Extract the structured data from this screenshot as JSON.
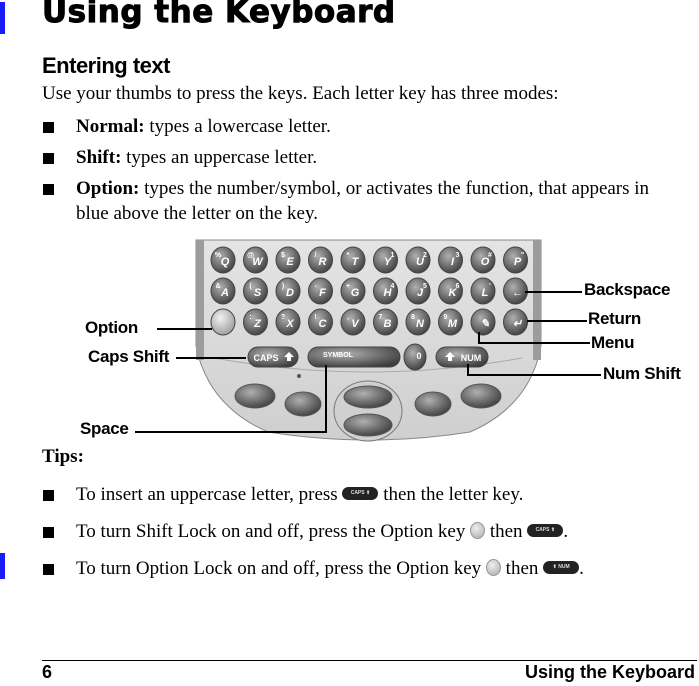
{
  "page": {
    "title": "Using the Keyboard",
    "section_heading": "Entering text",
    "intro": "Use your thumbs to press the keys. Each letter key has three modes:",
    "modes": [
      {
        "term": "Normal:",
        "text": " types a lowercase letter."
      },
      {
        "term": "Shift:",
        "text": " types an uppercase letter."
      },
      {
        "term": "Option:",
        "text": " types the number/symbol, or activates the function, that appears in blue above the letter on the key."
      }
    ],
    "figure": {
      "callouts": {
        "backspace": "Backspace",
        "return": "Return",
        "menu": "Menu",
        "num_shift": "Num Shift",
        "option": "Option",
        "caps_shift": "Caps Shift",
        "space": "Space"
      },
      "rows": [
        [
          {
            "k": "Q",
            "s": "%"
          },
          {
            "k": "W",
            "s": "@"
          },
          {
            "k": "E",
            "s": "$"
          },
          {
            "k": "R",
            "s": "/"
          },
          {
            "k": "T",
            "s": "*"
          },
          {
            "k": "Y",
            "s": "1"
          },
          {
            "k": "U",
            "s": "2"
          },
          {
            "k": "I",
            "s": "3"
          },
          {
            "k": "O",
            "s": "#"
          },
          {
            "k": "P",
            "s": "\""
          }
        ],
        [
          {
            "k": "A",
            "s": "&"
          },
          {
            "k": "S",
            "s": "("
          },
          {
            "k": "D",
            "s": ")"
          },
          {
            "k": "F",
            "s": "-"
          },
          {
            "k": "G",
            "s": "+"
          },
          {
            "k": "H",
            "s": "4"
          },
          {
            "k": "J",
            "s": "5"
          },
          {
            "k": "K",
            "s": "6"
          },
          {
            "k": "L",
            "s": "'"
          },
          {
            "k": "←",
            "s": ""
          }
        ],
        [
          {
            "k": "",
            "s": ""
          },
          {
            "k": "Z",
            "s": ":"
          },
          {
            "k": "X",
            "s": "?"
          },
          {
            "k": "C",
            "s": "!"
          },
          {
            "k": "V",
            "s": ","
          },
          {
            "k": "B",
            "s": "7"
          },
          {
            "k": "N",
            "s": "8"
          },
          {
            "k": "M",
            "s": "9"
          },
          {
            "k": "✎",
            "s": ""
          },
          {
            "k": "↵",
            "s": ""
          }
        ]
      ],
      "bottom_keys": {
        "caps": "CAPS",
        "symbol": "SYMBOL",
        "zero": "0",
        "num": "NUM"
      }
    },
    "tips_heading": "Tips:",
    "tips": [
      {
        "before": "To insert an uppercase letter, press ",
        "icon1": "caps-key",
        "mid": " then the letter key.",
        "icon2": "",
        "after": ""
      },
      {
        "before": "To turn Shift Lock on and off, press the Option key ",
        "icon1": "option-key",
        "mid": " then ",
        "icon2": "caps-key",
        "after": "."
      },
      {
        "before": "To turn Option Lock on and off, press the Option key ",
        "icon1": "option-key",
        "mid": " then ",
        "icon2": "num-key",
        "after": "."
      }
    ],
    "inline_labels": {
      "caps": "CAPS ⬆",
      "num": "⬆ NUM"
    },
    "footer": {
      "page_number": "6",
      "chapter": "Using the Keyboard"
    },
    "colors": {
      "changebar": "#1a1aff"
    }
  }
}
